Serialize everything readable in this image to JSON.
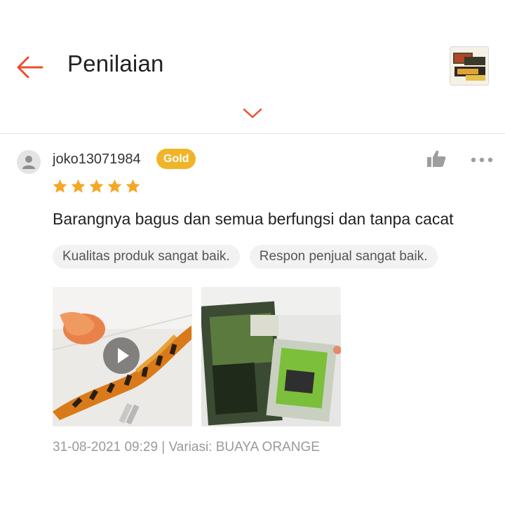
{
  "header": {
    "title": "Penilaian",
    "back_icon": "arrow-left-icon",
    "expand_icon": "chevron-down-icon",
    "accent_color": "#ee4d2d"
  },
  "review": {
    "username": "joko13071984",
    "badge": "Gold",
    "badge_color": "#f0b429",
    "rating": 5,
    "rating_max": 5,
    "text": "Barangnya bagus dan semua berfungsi dan tanpa cacat",
    "tags": [
      "Kualitas produk sangat baik.",
      "Respon penjual sangat baik."
    ],
    "meta": "31-08-2021 09:29 | Variasi: BUAYA ORANGE",
    "icons": {
      "like": "thumbs-up-icon",
      "more": "more-horizontal-icon",
      "avatar": "user-icon",
      "play": "play-icon"
    }
  }
}
